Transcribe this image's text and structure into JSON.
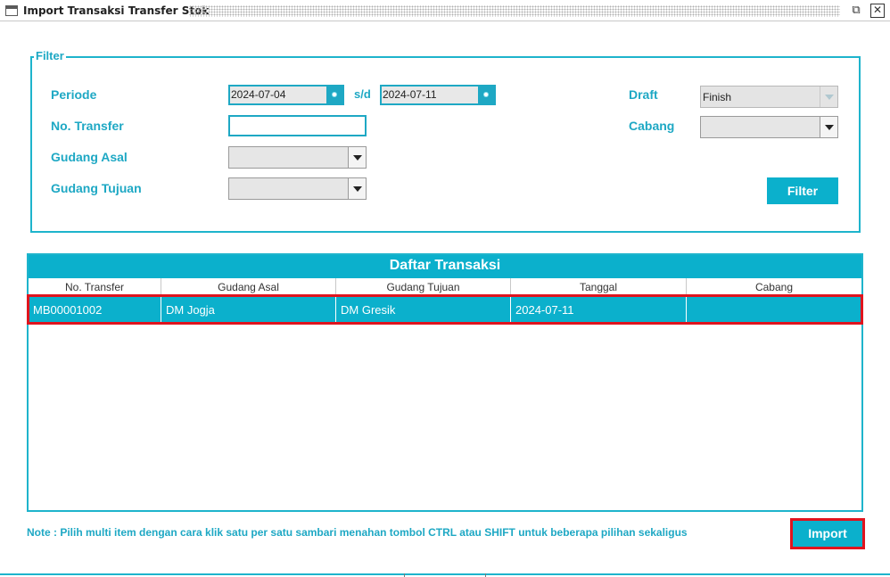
{
  "window": {
    "title": "Import Transaksi Transfer Stok",
    "restore_icon": "⧉",
    "close_icon": "✕"
  },
  "filter": {
    "legend": "Filter",
    "periode_label": "Periode",
    "periode_from": "2024-07-04",
    "sd_label": "s/d",
    "periode_to": "2024-07-11",
    "no_transfer_label": "No. Transfer",
    "no_transfer_value": "",
    "gudang_asal_label": "Gudang Asal",
    "gudang_asal_value": "",
    "gudang_tujuan_label": "Gudang Tujuan",
    "gudang_tujuan_value": "",
    "draft_label": "Draft",
    "draft_value": "Finish",
    "cabang_label": "Cabang",
    "cabang_value": "",
    "filter_button": "Filter"
  },
  "table": {
    "title": "Daftar Transaksi",
    "columns": [
      "No. Transfer",
      "Gudang Asal",
      "Gudang Tujuan",
      "Tanggal",
      "Cabang"
    ],
    "rows": [
      [
        "MB00001002",
        "DM Jogja",
        "DM Gresik",
        "2024-07-11",
        ""
      ]
    ]
  },
  "footer": {
    "note": "Note : Pilih multi item dengan cara klik satu per satu sambari menahan tombol CTRL atau SHIFT untuk beberapa pilihan sekaligus",
    "import_button": "Import"
  },
  "colors": {
    "accent": "#0bb0cc",
    "label": "#1ea8c4",
    "highlight": "#e0141e"
  }
}
